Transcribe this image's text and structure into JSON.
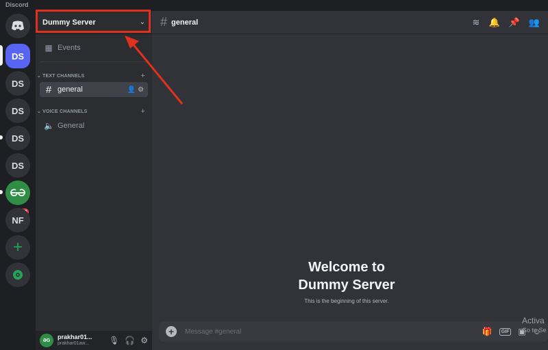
{
  "app": {
    "title": "Discord"
  },
  "rail": {
    "servers": [
      "DS",
      "DS",
      "DS",
      "DS",
      "DS",
      "NF"
    ],
    "gfg_badge": "10"
  },
  "sidebar": {
    "server_name": "Dummy Server",
    "events_label": "Events",
    "text_category": "TEXT CHANNELS",
    "text_channel": "general",
    "voice_category": "VOICE CHANNELS",
    "voice_channel": "General"
  },
  "user": {
    "name": "prakhar01...",
    "handle": "prakhar01aw...",
    "avatar_text": "ƏG"
  },
  "main": {
    "channel_name": "general",
    "welcome_line1": "Welcome to",
    "welcome_line2": "Dummy Server",
    "welcome_sub": "This is the beginning of this server.",
    "composer_placeholder": "Message #general",
    "gif_label": "GIF"
  },
  "overlay": {
    "activate_line1": "Activa",
    "activate_line2": "Go to Se"
  },
  "colors": {
    "accent": "#5865f2",
    "highlight": "#e0301e",
    "gfg": "#2f8d46",
    "badge": "#f23f43"
  }
}
